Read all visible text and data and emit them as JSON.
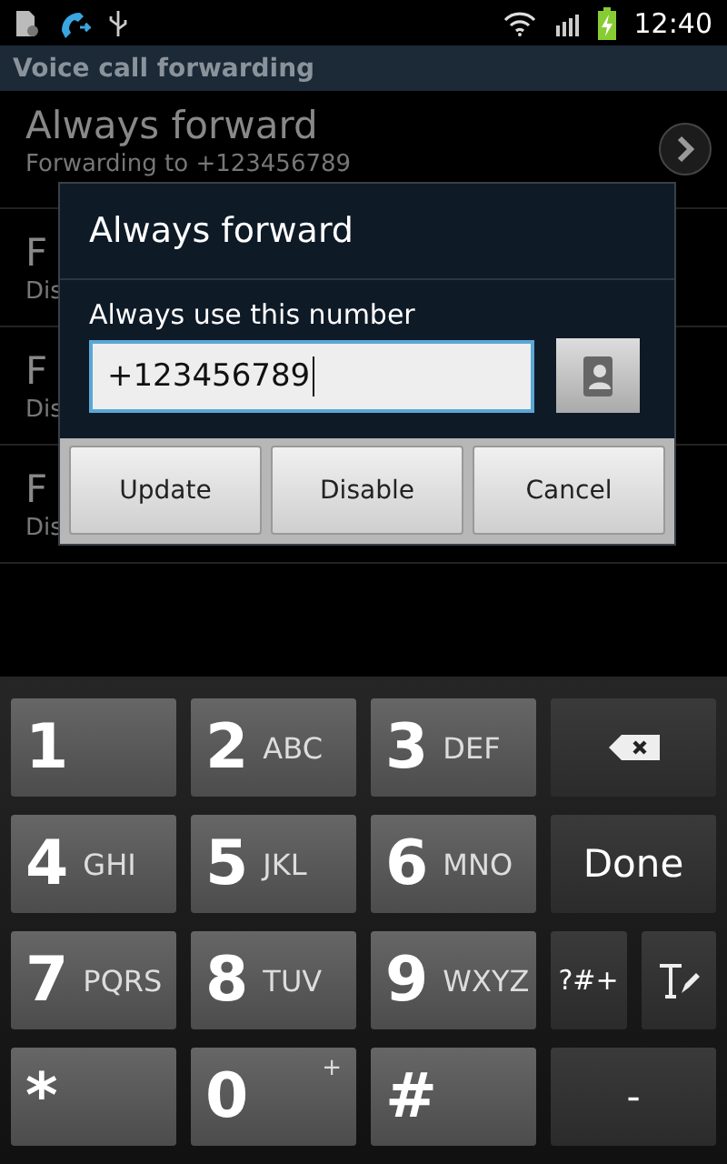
{
  "status_bar": {
    "time": "12:40"
  },
  "header": {
    "title": "Voice call forwarding"
  },
  "settings": [
    {
      "title": "Always forward",
      "subtitle": "Forwarding to +123456789"
    },
    {
      "title": "F",
      "subtitle": "Dis"
    },
    {
      "title": "F",
      "subtitle": "Dis"
    },
    {
      "title": "F",
      "subtitle": "Dis"
    }
  ],
  "dialog": {
    "title": "Always forward",
    "label": "Always use this number",
    "input": {
      "value": "+123456789"
    },
    "buttons": [
      "Update",
      "Disable",
      "Cancel"
    ]
  },
  "keyboard": {
    "keys": [
      {
        "kind": "digit",
        "label": "1"
      },
      {
        "kind": "digit",
        "label": "2",
        "letters": "ABC"
      },
      {
        "kind": "digit",
        "label": "3",
        "letters": "DEF"
      },
      {
        "kind": "backspace"
      },
      {
        "kind": "digit",
        "label": "4",
        "letters": "GHI"
      },
      {
        "kind": "digit",
        "label": "5",
        "letters": "JKL"
      },
      {
        "kind": "digit",
        "label": "6",
        "letters": "MNO"
      },
      {
        "kind": "text",
        "label": "Done"
      },
      {
        "kind": "digit",
        "label": "7",
        "letters": "PQRS"
      },
      {
        "kind": "digit",
        "label": "8",
        "letters": "TUV"
      },
      {
        "kind": "digit",
        "label": "9",
        "letters": "WXYZ"
      },
      {
        "kind": "half",
        "label": "?#+"
      },
      {
        "kind": "mode"
      },
      {
        "kind": "digit",
        "label": "*"
      },
      {
        "kind": "digit",
        "label": "0",
        "sup": "+"
      },
      {
        "kind": "digit",
        "label": "#"
      },
      {
        "kind": "text",
        "label": "-"
      }
    ]
  }
}
